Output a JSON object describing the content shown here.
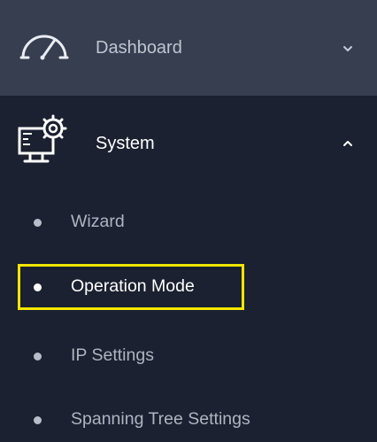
{
  "sidebar": {
    "dashboard": {
      "label": "Dashboard",
      "icon": "speedometer-icon",
      "expanded": false
    },
    "system": {
      "label": "System",
      "icon": "computer-settings-icon",
      "expanded": true,
      "items": [
        {
          "label": "Wizard",
          "active": false
        },
        {
          "label": "Operation Mode",
          "active": true
        },
        {
          "label": "IP Settings",
          "active": false
        },
        {
          "label": "Spanning Tree Settings",
          "active": false
        }
      ]
    }
  },
  "colors": {
    "sidebar_bg": "#1b2130",
    "header_active_bg": "#363e4f",
    "highlight": "#f2e600"
  }
}
